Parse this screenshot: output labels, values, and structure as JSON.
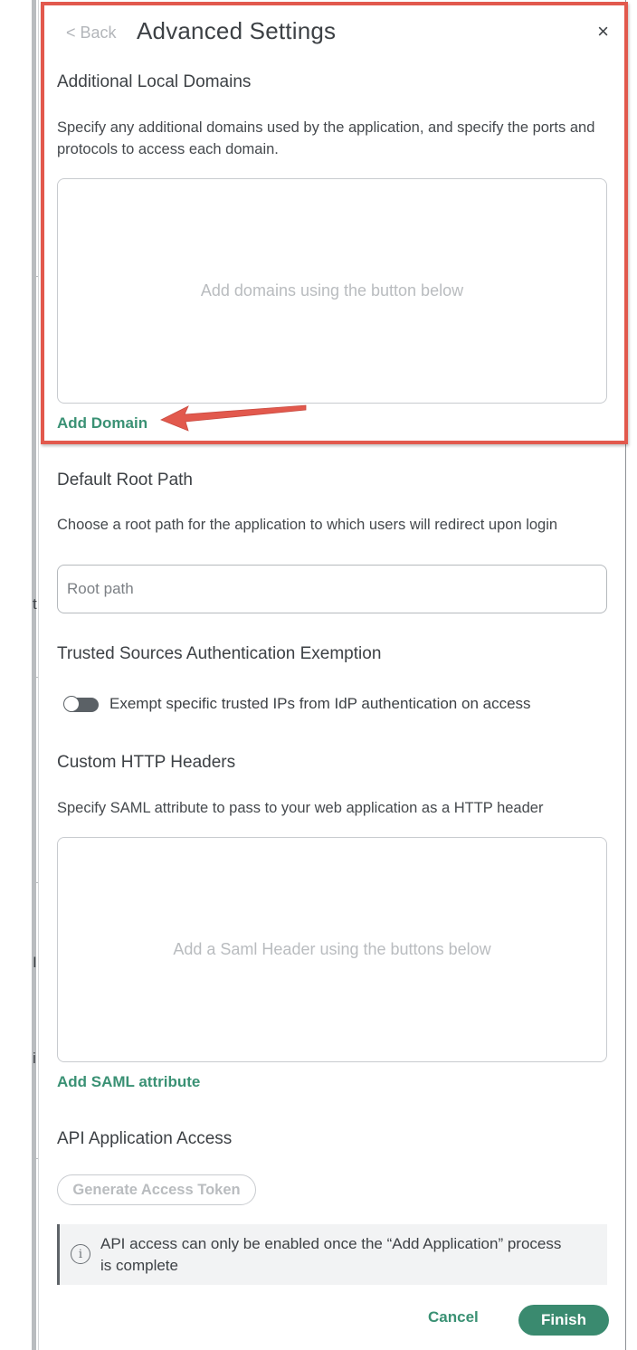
{
  "header": {
    "back_label": "< Back",
    "title": "Advanced Settings",
    "close_glyph": "×"
  },
  "domains": {
    "title": "Additional Local Domains",
    "description": "Specify any additional domains used by the application, and specify the ports and protocols to access each domain.",
    "empty_text": "Add domains using the button below",
    "add_label": "Add Domain"
  },
  "root_path": {
    "title": "Default Root Path",
    "description": "Choose a root path for the application to which users will redirect upon login",
    "placeholder": "Root path",
    "value": ""
  },
  "trusted_sources": {
    "title": "Trusted Sources Authentication Exemption",
    "toggle_label": "Exempt specific trusted IPs from IdP authentication on access",
    "toggle_on": false
  },
  "headers": {
    "title": "Custom HTTP Headers",
    "description": "Specify SAML attribute to pass to your web application as a HTTP header",
    "empty_text": "Add a Saml Header using the buttons below",
    "add_label": "Add SAML attribute"
  },
  "api_access": {
    "title": "API Application Access",
    "button_label": "Generate Access Token",
    "notice_icon": "info-icon",
    "notice_text": "API access can only be enabled once the “Add Application” process is complete"
  },
  "footer": {
    "cancel_label": "Cancel",
    "finish_label": "Finish"
  },
  "background_fragments": {
    "frag1": "t",
    "frag2": "I",
    "frag3": "i"
  },
  "colors": {
    "accent": "#3a9174",
    "primary_button": "#3a8a6f",
    "annotation": "#e2594d"
  }
}
